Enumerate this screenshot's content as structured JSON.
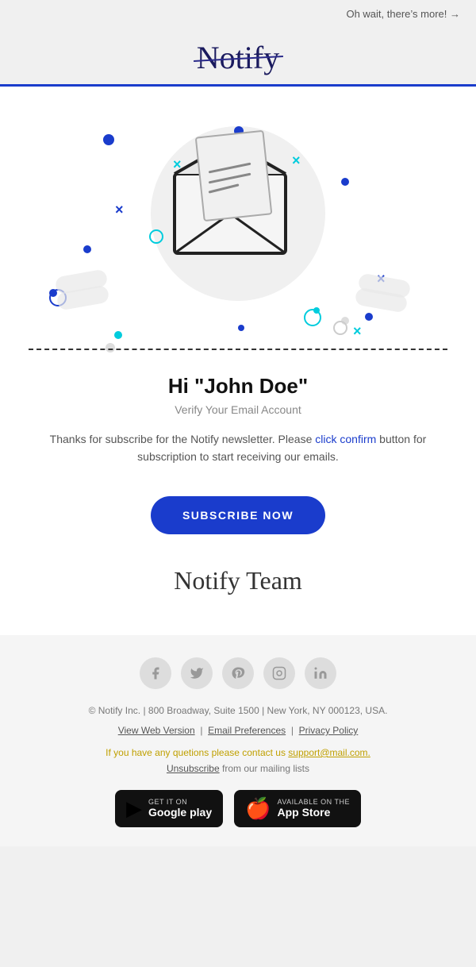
{
  "topbar": {
    "link_text": "Oh wait, there’s more! →"
  },
  "header": {
    "logo": "Notify"
  },
  "illustration": {
    "decorations": []
  },
  "content": {
    "greeting": "Hi \"John Doe\"",
    "subtitle": "Verify Your Email Account",
    "body_text": "Thanks for subscribe for the Notify newsletter. Please click confirm button for subscription to start receiving our emails.",
    "body_link": "click confirm",
    "subscribe_button": "SUBSCRIBE NOW",
    "signature": "Notify Team"
  },
  "footer": {
    "social_icons": [
      "f",
      "ᴛ",
      "p",
      "⦿",
      "in"
    ],
    "social_names": [
      "facebook",
      "twitter",
      "pinterest",
      "instagram",
      "linkedin"
    ],
    "address": "© Notify Inc. | 800 Broadway, Suite 1500 | New York, NY 000123, USA.",
    "links": [
      {
        "label": "View Web Version",
        "url": "#"
      },
      {
        "label": "Email Preferences",
        "url": "#"
      },
      {
        "label": "Privacy Policy",
        "url": "#"
      }
    ],
    "contact_text": "If you have any quetions please contact us",
    "contact_email": "support@mail.com.",
    "unsub_prefix": "",
    "unsub_link": "Unsubscribe",
    "unsub_suffix": "from our mailing lists",
    "google_play_small": "GET IT ON",
    "google_play_large": "Google play",
    "app_store_small": "Available on the",
    "app_store_large": "App Store"
  }
}
